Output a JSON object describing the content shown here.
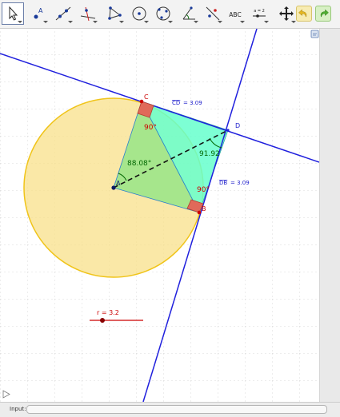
{
  "toolbar": {
    "tools": [
      {
        "name": "move-tool",
        "icon": "cursor-arrow-icon"
      },
      {
        "name": "point-tool",
        "icon": "point-a-icon"
      },
      {
        "name": "line-tool",
        "icon": "line-through-points-icon"
      },
      {
        "name": "perpendicular-line-tool",
        "icon": "perpendicular-line-icon"
      },
      {
        "name": "polygon-tool",
        "icon": "polygon-icon"
      },
      {
        "name": "circle-center-point-tool",
        "icon": "circle-center-point-icon"
      },
      {
        "name": "circle-three-points-tool",
        "icon": "circle-three-points-icon"
      },
      {
        "name": "angle-tool",
        "icon": "angle-icon"
      },
      {
        "name": "reflect-tool",
        "icon": "reflect-about-line-icon"
      },
      {
        "name": "text-tool",
        "icon": "text-abc-icon",
        "label": "ABC"
      },
      {
        "name": "slider-tool",
        "icon": "slider-icon",
        "label": "a = 2"
      },
      {
        "name": "move-graphics-view-tool",
        "icon": "move-view-icon"
      },
      {
        "name": "undo-button",
        "icon": "undo-arrow-icon"
      },
      {
        "name": "redo-button",
        "icon": "redo-arrow-icon"
      }
    ]
  },
  "graphics": {
    "points": {
      "A": "A",
      "B": "B",
      "C": "C",
      "D": "D"
    },
    "angles": {
      "right_C": "90°",
      "right_B": "90°",
      "angle_A": "88.08°",
      "angle_D": "91.92"
    },
    "lengths": {
      "CD_name": "CD",
      "CD_value": "= 3.09",
      "DB_name": "DB",
      "DB_value": "= 3.09"
    },
    "slider": {
      "label": "r = 3.2",
      "value": 3.2
    }
  },
  "input_bar": {
    "label": "Input:",
    "value": ""
  },
  "colors": {
    "tangent_lines": "#2020dd",
    "circle_fill": "#f8e08a",
    "circle_stroke": "#f0c419",
    "kite_fill": "#66ffcc",
    "quad_fill": "#9ce68a",
    "right_angle_marker": "#e06a5a",
    "point_red": "#cc0000",
    "slider_color": "#cc0000",
    "length_label_color": "#2020cc",
    "angle_text_green": "#006600",
    "angle_text_red": "#cc0000"
  }
}
